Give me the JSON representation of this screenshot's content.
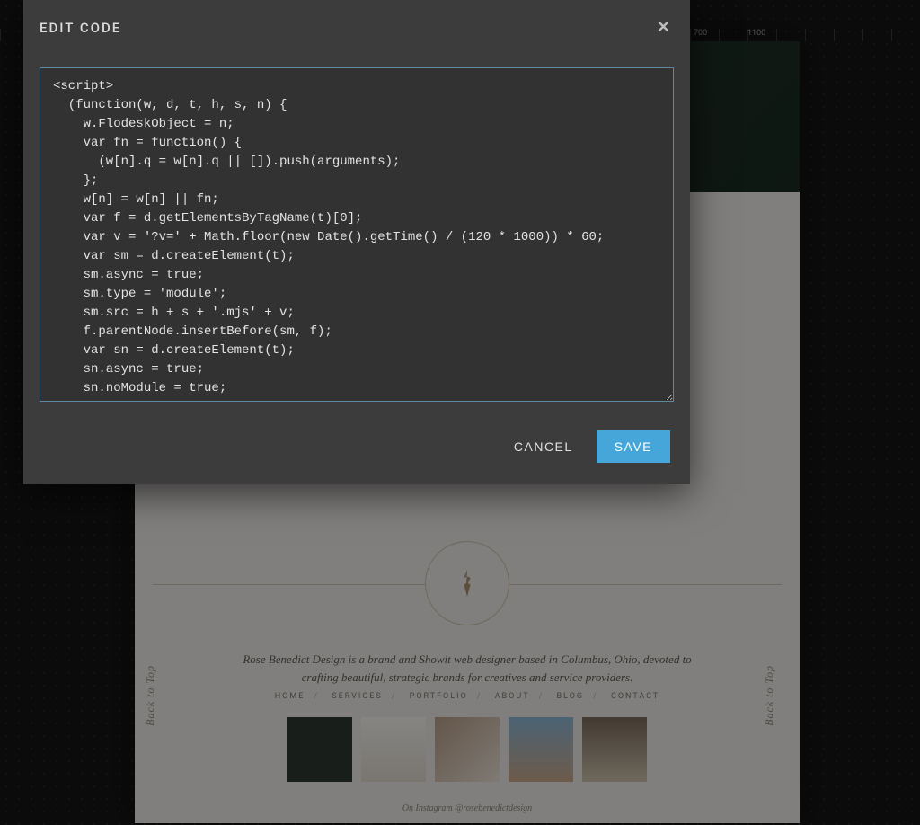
{
  "ruler": {
    "t1": "700",
    "t2": "1100"
  },
  "modal": {
    "title": "EDIT CODE",
    "cancel_label": "CANCEL",
    "save_label": "SAVE"
  },
  "code": {
    "value": "<script>\n  (function(w, d, t, h, s, n) {\n    w.FlodeskObject = n;\n    var fn = function() {\n      (w[n].q = w[n].q || []).push(arguments);\n    };\n    w[n] = w[n] || fn;\n    var f = d.getElementsByTagName(t)[0];\n    var v = '?v=' + Math.floor(new Date().getTime() / (120 * 1000)) * 60;\n    var sm = d.createElement(t);\n    sm.async = true;\n    sm.type = 'module';\n    sm.src = h + s + '.mjs' + v;\n    f.parentNode.insertBefore(sm, f);\n    var sn = d.createElement(t);\n    sn.async = true;\n    sn.noModule = true;"
  },
  "preview": {
    "tagline": "Rose Benedict Design is a brand and Showit web designer based in Columbus, Ohio, devoted to crafting beautiful, strategic brands for creatives and service providers.",
    "nav": [
      "HOME",
      "SERVICES",
      "PORTFOLIO",
      "ABOUT",
      "BLOG",
      "CONTACT"
    ],
    "instagram": "On Instagram @rosebenedictdesign",
    "back_to_top": "Back to Top"
  }
}
